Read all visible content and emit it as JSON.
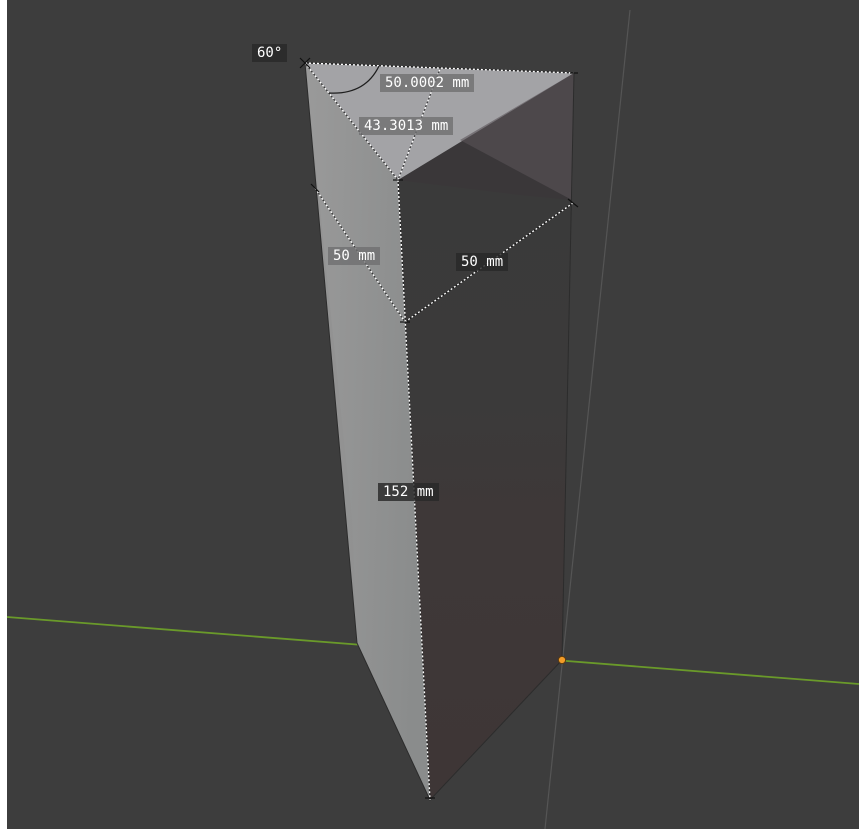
{
  "viewport": {
    "background_color": "#3d3d3d",
    "x_axis_color": "#6a9a2a",
    "origin_color": "#f39c28"
  },
  "measurements": {
    "angle": "60°",
    "top_edge": "50.0002 mm",
    "top_height": "43.3013 mm",
    "left_face_width": "50 mm",
    "right_face_width": "50 mm",
    "prism_height": "152 mm"
  }
}
